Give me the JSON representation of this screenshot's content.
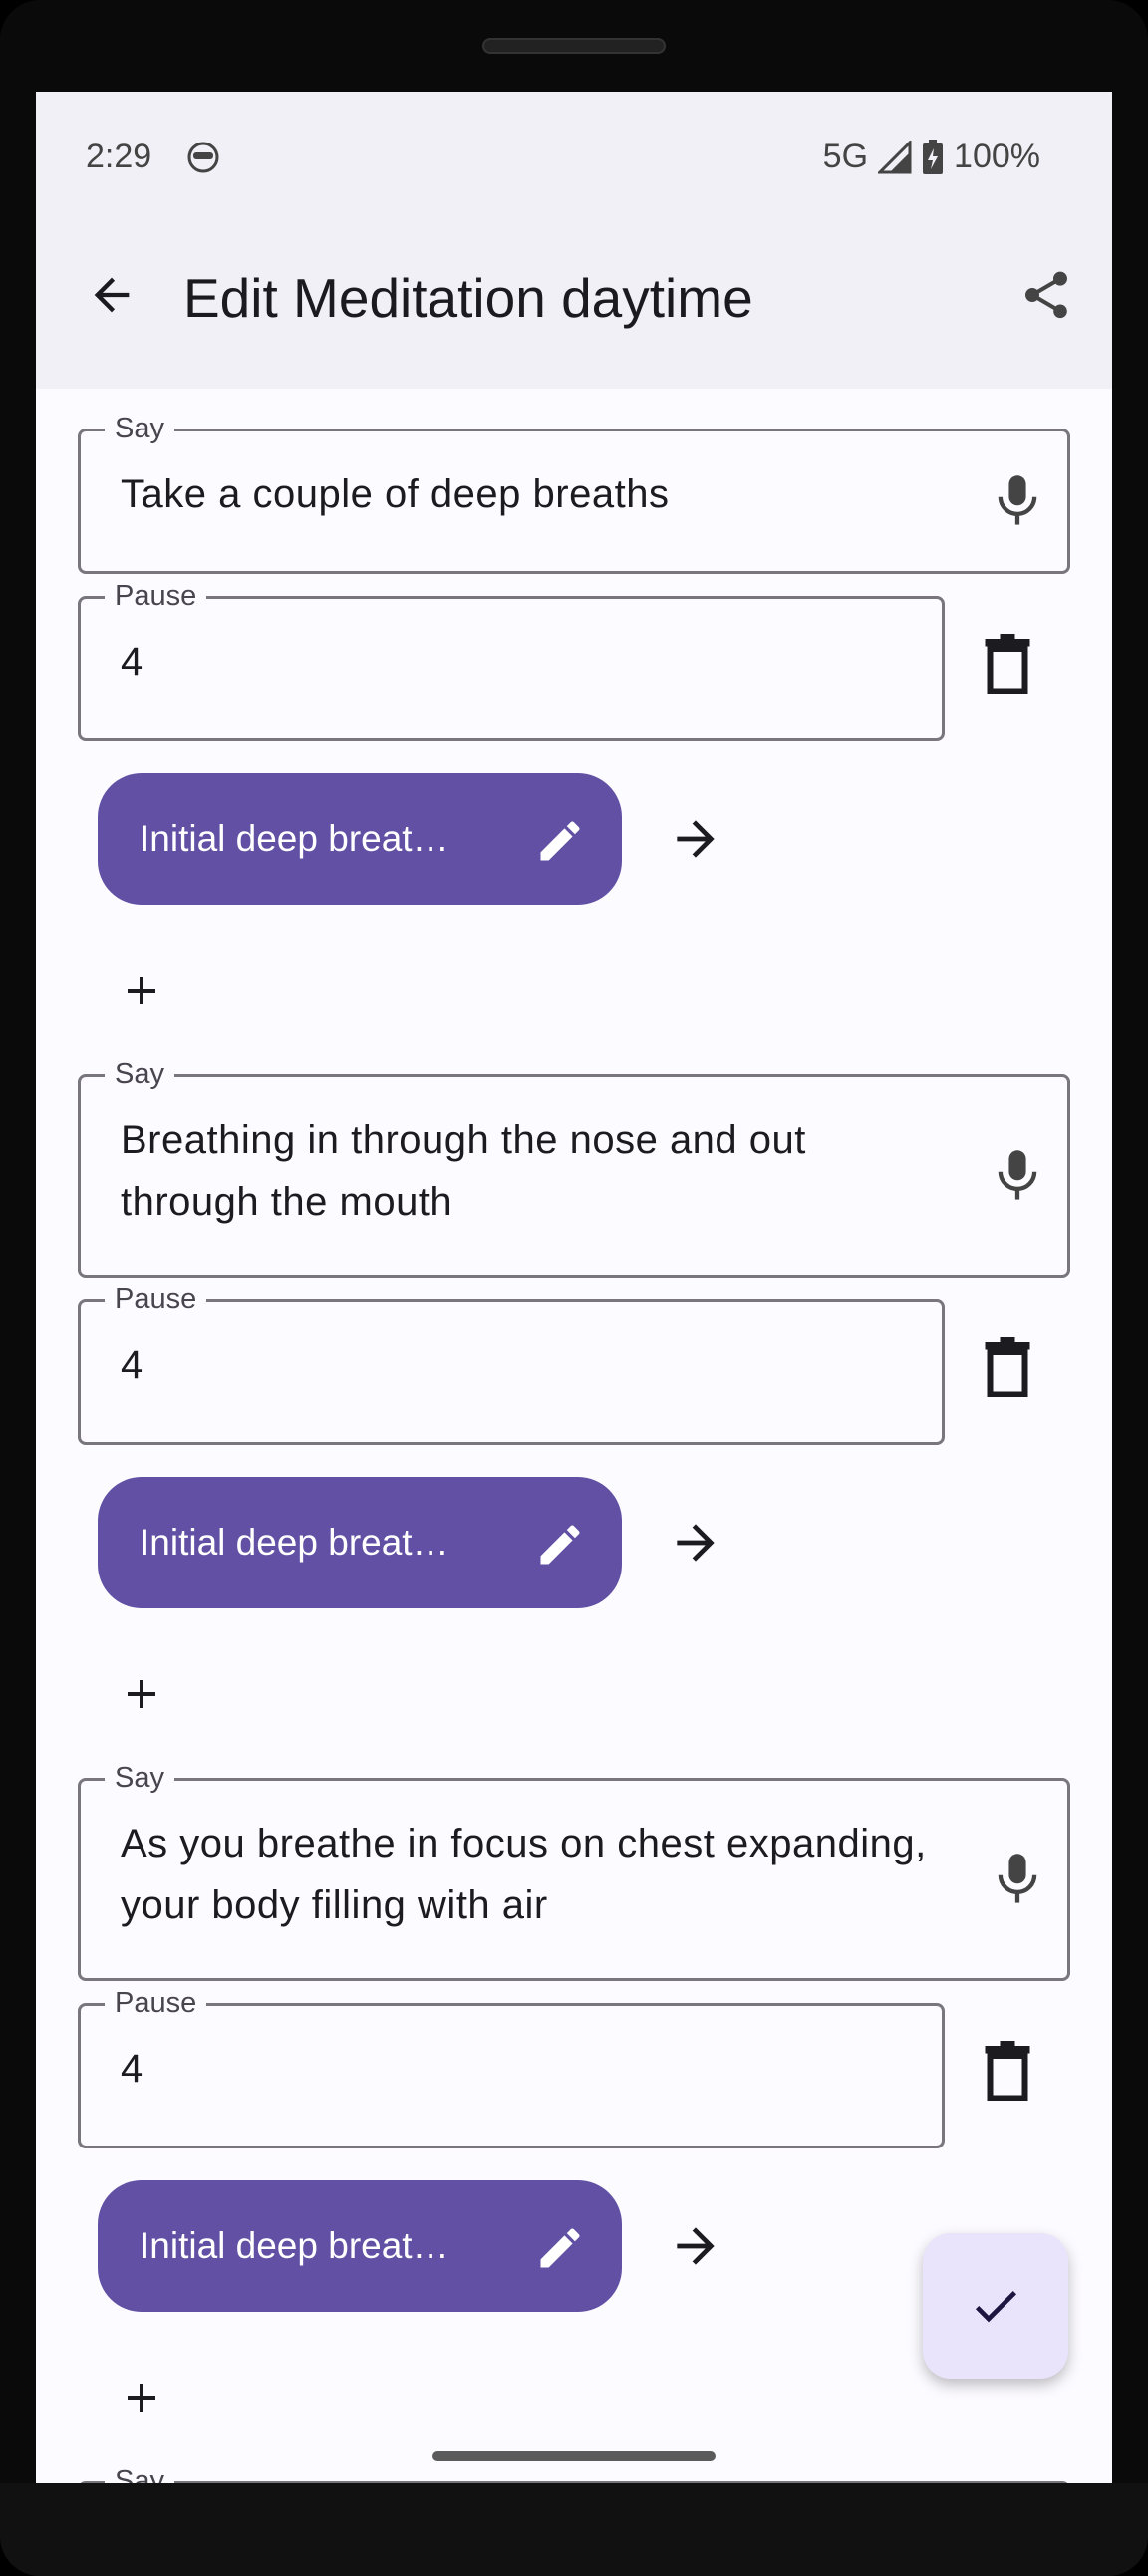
{
  "status_bar": {
    "time": "2:29",
    "network": "5G",
    "battery": "100%"
  },
  "header": {
    "title": "Edit Meditation daytime"
  },
  "steps": [
    {
      "say_label": "Say",
      "say_text": "Take a couple of deep breaths",
      "pause_label": "Pause",
      "pause_value": "4",
      "chip_label": "Initial deep breat…"
    },
    {
      "say_label": "Say",
      "say_text": "Breathing in through the nose and out through the mouth",
      "pause_label": "Pause",
      "pause_value": "4",
      "chip_label": "Initial deep breat…"
    },
    {
      "say_label": "Say",
      "say_text": "As you breathe in focus on chest expanding, your body filling with air",
      "pause_label": "Pause",
      "pause_value": "4",
      "chip_label": "Initial deep breat…"
    },
    {
      "say_label": "Say"
    }
  ],
  "colors": {
    "accent": "#6250a4",
    "fab_bg": "#e9e4fb",
    "appbar_bg": "#f1f0f6",
    "screen_bg": "#fcfbff"
  },
  "icons": [
    "back-arrow-icon",
    "share-icon",
    "mic-icon",
    "trash-icon",
    "pencil-icon",
    "arrow-right-icon",
    "plus-icon",
    "check-icon"
  ]
}
